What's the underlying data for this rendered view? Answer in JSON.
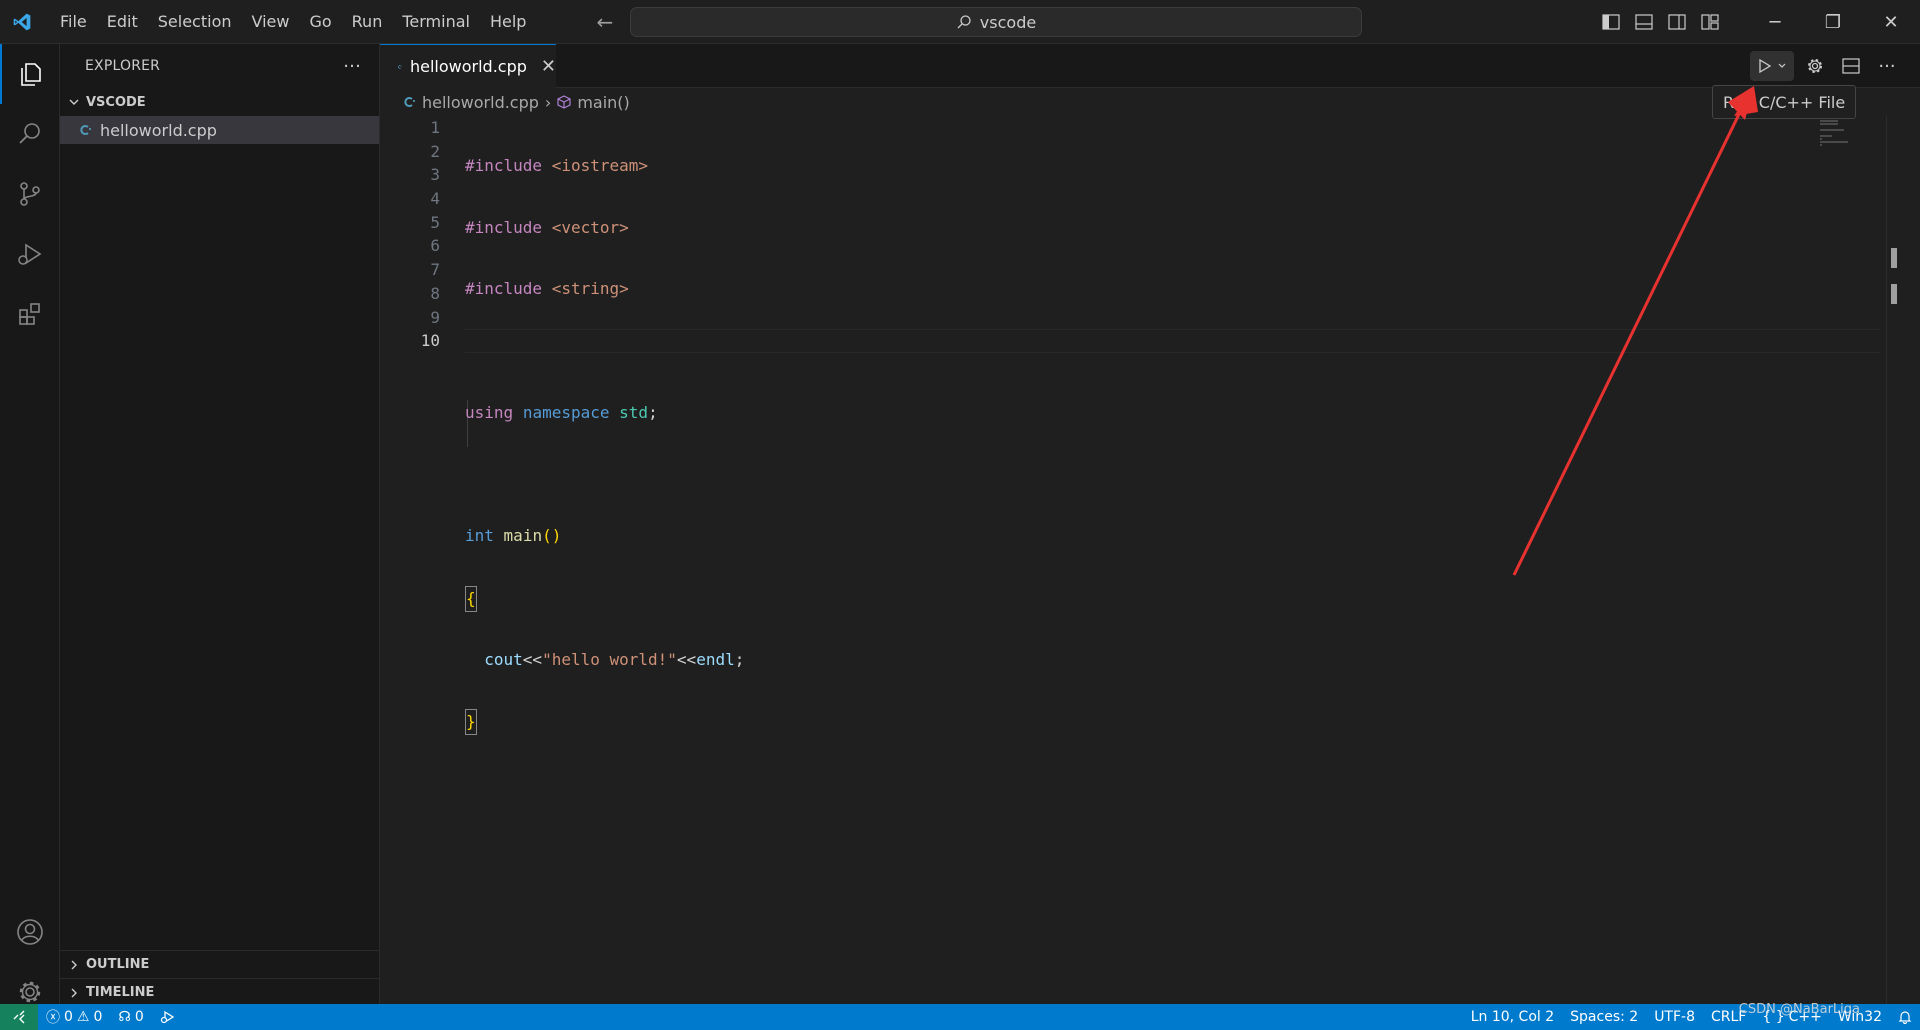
{
  "titlebar": {
    "menu": [
      "File",
      "Edit",
      "Selection",
      "View",
      "Go",
      "Run",
      "Terminal",
      "Help"
    ],
    "command_center": "vscode"
  },
  "sidebar": {
    "title": "EXPLORER",
    "folder": "VSCODE",
    "files": [
      "helloworld.cpp"
    ],
    "outline": "OUTLINE",
    "timeline": "TIMELINE"
  },
  "editor": {
    "tab_label": "helloworld.cpp",
    "breadcrumb_file": "helloworld.cpp",
    "breadcrumb_symbol": "main()",
    "line_numbers": [
      "1",
      "2",
      "3",
      "4",
      "5",
      "6",
      "7",
      "8",
      "9",
      "10"
    ],
    "current_line": 10,
    "code": {
      "l1_kw": "#include",
      "l1_hdr": "<iostream>",
      "l2_kw": "#include",
      "l2_hdr": "<vector>",
      "l3_kw": "#include",
      "l3_hdr": "<string>",
      "l5_using": "using",
      "l5_ns": "namespace",
      "l5_std": "std",
      "l5_semi": ";",
      "l7_int": "int",
      "l7_main": "main",
      "l7_parens": "()",
      "l8": "{",
      "l9_cout": "cout",
      "l9_op1": "<<",
      "l9_str": "\"hello world!\"",
      "l9_op2": "<<",
      "l9_endl": "endl",
      "l9_semi": ";",
      "l10": "}"
    }
  },
  "tooltip": "Run C/C++ File",
  "statusbar": {
    "errors": "0",
    "warnings": "0",
    "ports": "0",
    "position": "Ln 10, Col 2",
    "spaces": "Spaces: 2",
    "encoding": "UTF-8",
    "eol": "CRLF",
    "language": "C++",
    "platform": "Win32"
  },
  "watermark": "CSDN @NaBarLiga",
  "colors": {
    "accent": "#0078d4",
    "statusbar": "#007acc",
    "remote": "#16825d",
    "arrow": "#e8322f"
  }
}
